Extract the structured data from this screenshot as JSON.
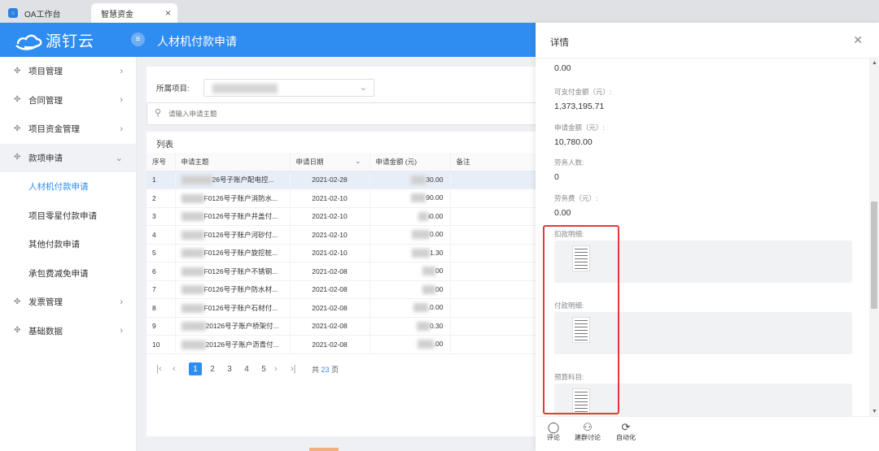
{
  "browser": {
    "tabs": [
      {
        "label": "OA工作台"
      },
      {
        "label": "智慧资金"
      }
    ]
  },
  "header": {
    "logo_text": "源钉云",
    "title": "人材机付款申请"
  },
  "sidebar": {
    "items": [
      {
        "label": "项目管理"
      },
      {
        "label": "合同管理"
      },
      {
        "label": "项目资金管理"
      },
      {
        "label": "款项申请"
      },
      {
        "label": "发票管理"
      },
      {
        "label": "基础数据"
      }
    ],
    "sub_items": [
      {
        "label": "人材机付款申请"
      },
      {
        "label": "项目零星付款申请"
      },
      {
        "label": "其他付款申请"
      },
      {
        "label": "承包费减免申请"
      }
    ]
  },
  "filter": {
    "project_label": "所属项目:"
  },
  "search": {
    "placeholder": "请输入申请主题"
  },
  "list": {
    "title": "列表",
    "columns": [
      "序号",
      "申请主题",
      "申请日期",
      "申请金额 (元)",
      "备注"
    ],
    "rows": [
      {
        "no": "1",
        "subject": "26号子账户配电控...",
        "date": "2021-02-28",
        "amount": "30.00",
        "note": ""
      },
      {
        "no": "2",
        "subject": "F0126号子账户消防水...",
        "date": "2021-02-10",
        "amount": "90.00",
        "note": ""
      },
      {
        "no": "3",
        "subject": "F0126号子账户井盖付...",
        "date": "2021-02-10",
        "amount": "i0.00",
        "note": ""
      },
      {
        "no": "4",
        "subject": "F0126号子账户河砂付...",
        "date": "2021-02-10",
        "amount": "0.00",
        "note": ""
      },
      {
        "no": "5",
        "subject": "F0126号子账户旋挖桩...",
        "date": "2021-02-10",
        "amount": "1.30",
        "note": ""
      },
      {
        "no": "6",
        "subject": "F0126号子账户不锈钢...",
        "date": "2021-02-08",
        "amount": "00",
        "note": ""
      },
      {
        "no": "7",
        "subject": "F0126号子账户防水材...",
        "date": "2021-02-08",
        "amount": "00",
        "note": ""
      },
      {
        "no": "8",
        "subject": "F0126号子账户石材付...",
        "date": "2021-02-08",
        "amount": ".0.00",
        "note": ""
      },
      {
        "no": "9",
        "subject": "20126号子账户桥架付...",
        "date": "2021-02-08",
        "amount": "0.30",
        "note": ""
      },
      {
        "no": "10",
        "subject": "20126号子账户沥青付...",
        "date": "2021-02-08",
        "amount": ".00",
        "note": ""
      }
    ]
  },
  "pagination": {
    "pages": [
      "1",
      "2",
      "3",
      "4",
      "5"
    ],
    "current": "1",
    "total_prefix": "共",
    "total_pages": "23",
    "total_suffix": "页"
  },
  "drawer": {
    "title": "详情",
    "fields": [
      {
        "label": "",
        "value": "0.00"
      },
      {
        "label": "可支付金额（元）:",
        "value": "1,373,195.71"
      },
      {
        "label": "申请金额（元）:",
        "value": "10,780.00"
      },
      {
        "label": "劳务人数:",
        "value": "0"
      },
      {
        "label": "劳务费（元）:",
        "value": "0.00"
      }
    ],
    "attachments": [
      {
        "label": "扣款明细:"
      },
      {
        "label": "付款明细:"
      },
      {
        "label": "预算科目:"
      }
    ],
    "footer": [
      {
        "label": "评论",
        "icon": "comment-icon"
      },
      {
        "label": "建群讨论",
        "icon": "group-chat-icon"
      },
      {
        "label": "自动化",
        "icon": "automation-icon"
      }
    ]
  },
  "colors": {
    "brand": "#2f8cf0",
    "highlight_box": "#e53935"
  }
}
